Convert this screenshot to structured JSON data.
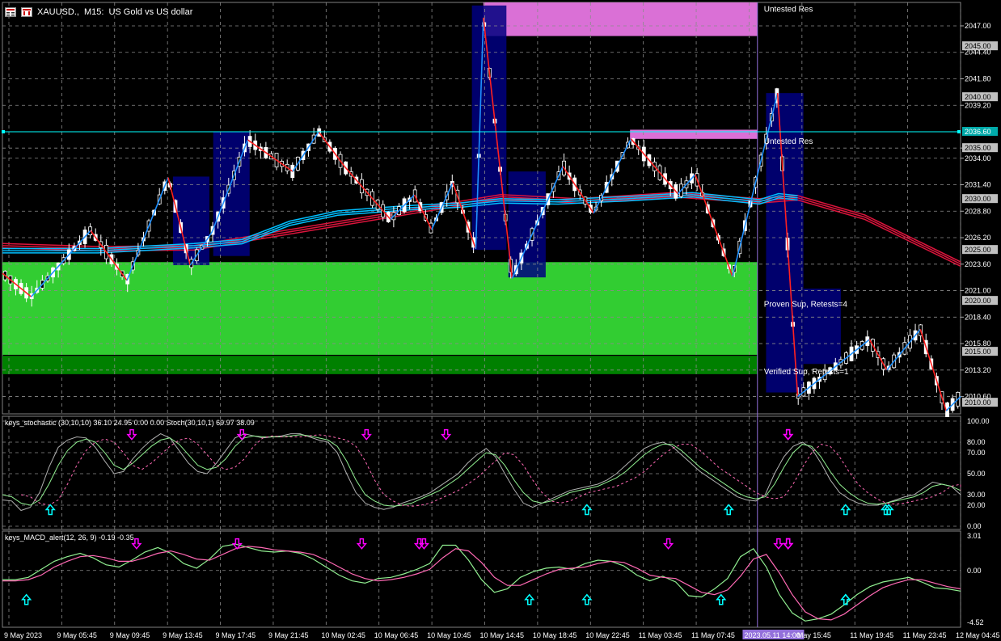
{
  "header": {
    "symbol": "XAUUSD.,",
    "timeframe": "M15:",
    "description": "US Gold vs US dollar"
  },
  "colors": {
    "background": "#000000",
    "bull_candle": "#ffffff",
    "bear_candle": "#ffffff",
    "zigzag_up": "#1e90ff",
    "zigzag_down": "#ff2020",
    "ma_fast": "#00bfff",
    "ma_slow": "#dc143c",
    "resistance_zone": "#da70d6",
    "support_proven": "#32cd32",
    "support_verified": "#008000",
    "box": "#000080",
    "hline": "#00ffff",
    "stoch_main": "#90ee90",
    "stoch_signal": "#ff69b4",
    "macd_main": "#90ee90",
    "macd_signal": "#ff69b4",
    "arrow_up": "#00ffff",
    "arrow_down": "#ff00ff"
  },
  "chart_data": [
    {
      "type": "candlestick",
      "panel": "price",
      "ylim": [
        2008.9,
        2049.3
      ],
      "price_ticks": [
        "2047.00",
        "2044.40",
        "2041.80",
        "2039.20",
        "2035.00",
        "2034.00",
        "2031.40",
        "2028.80",
        "2026.20",
        "2023.60",
        "2021.00",
        "2018.40",
        "2015.80",
        "2013.20",
        "2010.60"
      ],
      "price_tick_values": [
        2047.0,
        2044.4,
        2041.8,
        2039.2,
        2035.0,
        2034.0,
        2031.4,
        2028.8,
        2026.2,
        2023.6,
        2021.0,
        2018.4,
        2015.8,
        2013.2,
        2010.6
      ],
      "highlighted_levels": [
        "2045.00",
        "2040.00",
        "2036.60",
        "2035.00",
        "2030.00",
        "2025.00",
        "2020.00",
        "2015.00",
        "2010.00"
      ],
      "highlighted_level_values": [
        2045.0,
        2040.0,
        2036.6,
        2035.0,
        2030.0,
        2025.0,
        2020.0,
        2015.0,
        2010.0
      ],
      "current_price_line": 2036.6,
      "zones": [
        {
          "label": "Untested Res",
          "type": "resistance",
          "x0": 0.502,
          "x1": 0.788,
          "y0": 2046.0,
          "y1": 2049.3
        },
        {
          "label": "Untested Res",
          "type": "resistance",
          "x0": 0.655,
          "x1": 0.788,
          "y0": 2035.9,
          "y1": 2036.8
        },
        {
          "label": "Proven Sup, Retests=4",
          "type": "support_proven",
          "x0": 0.0,
          "x1": 0.788,
          "y0": 2014.7,
          "y1": 2023.8
        },
        {
          "label": "Verified Sup, Retests=1",
          "type": "support_verified",
          "x0": 0.0,
          "x1": 0.788,
          "y0": 2012.8,
          "y1": 2014.6
        }
      ],
      "zone_labels": [
        "Untested Res",
        "Untested Res",
        "Proven Sup, Retests=4",
        "Verified Sup, Retests=1"
      ],
      "zigzag": [
        {
          "x": 0.0,
          "y": 2022.7
        },
        {
          "x": 0.03,
          "y": 2020.4
        },
        {
          "x": 0.092,
          "y": 2026.9
        },
        {
          "x": 0.13,
          "y": 2022.0
        },
        {
          "x": 0.173,
          "y": 2032.1
        },
        {
          "x": 0.196,
          "y": 2023.5
        },
        {
          "x": 0.219,
          "y": 2026.8
        },
        {
          "x": 0.256,
          "y": 2035.8
        },
        {
          "x": 0.303,
          "y": 2032.7
        },
        {
          "x": 0.33,
          "y": 2036.6
        },
        {
          "x": 0.357,
          "y": 2033.2
        },
        {
          "x": 0.405,
          "y": 2028.0
        },
        {
          "x": 0.43,
          "y": 2030.4
        },
        {
          "x": 0.448,
          "y": 2027.0
        },
        {
          "x": 0.47,
          "y": 2031.6
        },
        {
          "x": 0.494,
          "y": 2025.1
        },
        {
          "x": 0.502,
          "y": 2047.8
        },
        {
          "x": 0.532,
          "y": 2022.2
        },
        {
          "x": 0.585,
          "y": 2033.2
        },
        {
          "x": 0.617,
          "y": 2028.6
        },
        {
          "x": 0.656,
          "y": 2035.9
        },
        {
          "x": 0.705,
          "y": 2030.5
        },
        {
          "x": 0.723,
          "y": 2032.4
        },
        {
          "x": 0.762,
          "y": 2022.4
        },
        {
          "x": 0.809,
          "y": 2040.4
        },
        {
          "x": 0.83,
          "y": 2010.6
        },
        {
          "x": 0.905,
          "y": 2016.2
        },
        {
          "x": 0.923,
          "y": 2013.2
        },
        {
          "x": 0.958,
          "y": 2017.2
        },
        {
          "x": 0.985,
          "y": 2009.2
        },
        {
          "x": 1.0,
          "y": 2010.6
        }
      ],
      "moving_averages": {
        "fast": [
          {
            "x": 0.0,
            "y": 2024.7
          },
          {
            "x": 0.1,
            "y": 2024.7
          },
          {
            "x": 0.2,
            "y": 2025.2
          },
          {
            "x": 0.25,
            "y": 2025.6
          },
          {
            "x": 0.3,
            "y": 2027.4
          },
          {
            "x": 0.35,
            "y": 2028.4
          },
          {
            "x": 0.42,
            "y": 2028.9
          },
          {
            "x": 0.48,
            "y": 2029.2
          },
          {
            "x": 0.52,
            "y": 2029.6
          },
          {
            "x": 0.58,
            "y": 2029.5
          },
          {
            "x": 0.65,
            "y": 2029.8
          },
          {
            "x": 0.72,
            "y": 2030.2
          },
          {
            "x": 0.79,
            "y": 2029.5
          },
          {
            "x": 0.81,
            "y": 2030.1
          },
          {
            "x": 0.83,
            "y": 2029.9
          }
        ],
        "slow": [
          {
            "x": 0.0,
            "y": 2025.2
          },
          {
            "x": 0.1,
            "y": 2024.9
          },
          {
            "x": 0.2,
            "y": 2025.0
          },
          {
            "x": 0.52,
            "y": 2030.0
          },
          {
            "x": 0.6,
            "y": 2029.6
          },
          {
            "x": 0.7,
            "y": 2030.2
          },
          {
            "x": 0.79,
            "y": 2029.6
          },
          {
            "x": 0.83,
            "y": 2029.9
          },
          {
            "x": 0.9,
            "y": 2028.0
          },
          {
            "x": 1.0,
            "y": 2023.4
          }
        ]
      },
      "boxes": [
        {
          "x0": 0.178,
          "x1": 0.216,
          "y0": 2023.5,
          "y1": 2032.2
        },
        {
          "x0": 0.22,
          "x1": 0.258,
          "y0": 2024.4,
          "y1": 2036.6
        },
        {
          "x0": 0.49,
          "x1": 0.526,
          "y0": 2025.0,
          "y1": 2049.0
        },
        {
          "x0": 0.528,
          "x1": 0.567,
          "y0": 2022.3,
          "y1": 2032.7
        },
        {
          "x0": 0.797,
          "x1": 0.836,
          "y0": 2011.0,
          "y1": 2040.4
        },
        {
          "x0": 0.836,
          "x1": 0.875,
          "y0": 2013.8,
          "y1": 2021.2
        }
      ],
      "vline_x": 0.788
    },
    {
      "type": "line",
      "panel": "stochastic",
      "title": "keys_stochastic (30,10,10) 36.10 24.95 0.00 0.00 Stoch(30,10,1) 69.97 38.09",
      "ylim": [
        0,
        100
      ],
      "ticks": [
        "100.00",
        "80.00",
        "70.00",
        "50.00",
        "30.00",
        "20.00",
        "0.00"
      ],
      "tick_values": [
        100,
        80,
        70,
        50,
        30,
        20,
        0
      ],
      "series": [
        {
          "name": "",
          "values": [
            25,
            24,
            15,
            18,
            32,
            56,
            75,
            82,
            85,
            84,
            75,
            62,
            50,
            52,
            64,
            74,
            82,
            88,
            84,
            72,
            60,
            52,
            50,
            60,
            72,
            84,
            88,
            86,
            84,
            85,
            86,
            88,
            88,
            85,
            82,
            80,
            70,
            50,
            32,
            22,
            18,
            16,
            18,
            22,
            25,
            28,
            32,
            38,
            44,
            50,
            60,
            68,
            74,
            66,
            50,
            35,
            22,
            18,
            22,
            26,
            30,
            34,
            36,
            38,
            40,
            44,
            50,
            58,
            66,
            74,
            78,
            80,
            76,
            68,
            60,
            52,
            46,
            40,
            34,
            28,
            25,
            24,
            30,
            50,
            66,
            76,
            80,
            74,
            60,
            44,
            32,
            26,
            22,
            20,
            20,
            22,
            25,
            28,
            30,
            36,
            42,
            40,
            38,
            30
          ]
        },
        {
          "name": "",
          "values": [
            30,
            28,
            22,
            20,
            25,
            40,
            58,
            72,
            80,
            83,
            80,
            70,
            58,
            54,
            60,
            68,
            76,
            82,
            84,
            78,
            68,
            58,
            54,
            56,
            64,
            76,
            84,
            86,
            85,
            85,
            85,
            86,
            87,
            86,
            84,
            82,
            76,
            62,
            44,
            30,
            24,
            20,
            19,
            20,
            22,
            26,
            30,
            34,
            40,
            46,
            54,
            62,
            70,
            68,
            58,
            44,
            32,
            24,
            22,
            24,
            28,
            32,
            34,
            36,
            38,
            42,
            46,
            52,
            60,
            68,
            74,
            78,
            78,
            72,
            64,
            56,
            50,
            44,
            38,
            32,
            28,
            26,
            28,
            40,
            56,
            70,
            78,
            76,
            66,
            52,
            40,
            32,
            26,
            22,
            21,
            22,
            24,
            26,
            28,
            32,
            38,
            40,
            38,
            34
          ]
        }
      ]
    },
    {
      "type": "line",
      "panel": "macd",
      "title": "keys_MACD_alert(12, 26, 9) -0.19 -0.35",
      "ylim": [
        -4.52,
        3.01
      ],
      "ticks": [
        "3.01",
        "0.00",
        "-4.52"
      ],
      "tick_values": [
        3.01,
        0.0,
        -4.52
      ],
      "series": [
        {
          "name": "",
          "values": [
            -0.8,
            -0.8,
            -0.6,
            0.1,
            0.8,
            1.2,
            1.5,
            1.1,
            0.5,
            0.3,
            0.9,
            1.6,
            2.0,
            1.5,
            0.6,
            0.2,
            1.0,
            2.1,
            2.3,
            2.0,
            1.7,
            1.6,
            1.7,
            1.5,
            1.0,
            0.3,
            -0.4,
            -0.9,
            -1.1,
            -0.7,
            -0.6,
            -0.3,
            0.1,
            0.6,
            2.2,
            2.2,
            0.9,
            -0.8,
            -1.9,
            -1.6,
            -0.6,
            -0.1,
            0.2,
            0.3,
            0.1,
            0.6,
            0.9,
            0.8,
            0.4,
            -0.4,
            -0.9,
            -0.5,
            -1.0,
            -2.2,
            -2.3,
            -1.6,
            -0.7,
            1.2,
            1.9,
            0.3,
            -2.1,
            -3.7,
            -4.4,
            -4.2,
            -3.8,
            -3.0,
            -2.1,
            -1.4,
            -1.0,
            -0.8,
            -0.6,
            -1.0,
            -1.5,
            -1.6,
            -1.8
          ]
        },
        {
          "name": "",
          "values": [
            -0.9,
            -0.9,
            -0.8,
            -0.4,
            0.3,
            0.8,
            1.2,
            1.3,
            1.1,
            0.8,
            0.8,
            1.1,
            1.5,
            1.7,
            1.4,
            1.0,
            0.9,
            1.4,
            1.9,
            2.1,
            2.0,
            1.8,
            1.7,
            1.6,
            1.4,
            0.9,
            0.3,
            -0.3,
            -0.7,
            -0.9,
            -0.8,
            -0.6,
            -0.3,
            0.1,
            1.1,
            1.9,
            1.7,
            0.7,
            -0.6,
            -1.3,
            -1.3,
            -0.8,
            -0.3,
            0.1,
            0.2,
            0.3,
            0.6,
            0.8,
            0.7,
            0.2,
            -0.4,
            -0.6,
            -0.7,
            -1.3,
            -1.9,
            -2.1,
            -1.7,
            -0.5,
            1.0,
            1.4,
            -0.2,
            -2.1,
            -3.6,
            -4.2,
            -4.3,
            -3.8,
            -3.0,
            -2.2,
            -1.5,
            -1.1,
            -0.8,
            -0.8,
            -1.1,
            -1.4,
            -1.6
          ]
        }
      ]
    }
  ],
  "panels": {
    "stoch_arrows_up": [
      0.05,
      0.61,
      0.758,
      0.88,
      0.925,
      0.922
    ],
    "stoch_arrows_down": [
      0.135,
      0.25,
      0.38,
      0.463,
      0.895,
      1.0
    ],
    "macd_arrows_up": [
      0.025,
      0.55,
      0.61,
      0.75,
      0.96,
      1.03
    ],
    "macd_arrows_down": [
      0.14,
      0.245,
      0.375,
      0.435,
      0.44,
      0.695,
      0.81,
      0.82,
      0.895,
      1.09
    ]
  },
  "time_axis": {
    "labels": [
      "9 May 2023",
      "9 May 05:45",
      "9 May 09:45",
      "9 May 13:45",
      "9 May 17:45",
      "9 May 21:45",
      "10 May 02:45",
      "10 May 06:45",
      "10 May 10:45",
      "10 May 14:45",
      "10 May 18:45",
      "10 May 22:45",
      "11 May 03:45",
      "11 May 07:45",
      "2023.05.11 14:00",
      "May 15:45",
      "11 May 19:45",
      "11 May 23:45",
      "12 May 04:45"
    ],
    "highlighted_label": "2023.05.11 14:00"
  }
}
